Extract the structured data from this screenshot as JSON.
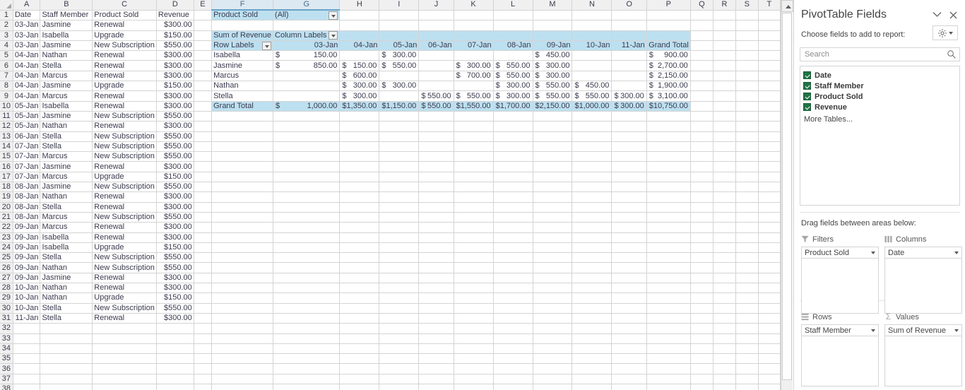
{
  "spreadsheet": {
    "column_letters": [
      "A",
      "B",
      "C",
      "D",
      "E",
      "F",
      "G",
      "H",
      "I",
      "J",
      "K",
      "L",
      "M",
      "N",
      "O",
      "P",
      "Q",
      "R",
      "S",
      "T"
    ],
    "selected_columns": [
      "F",
      "G"
    ],
    "source_table": {
      "headers": [
        "Date",
        "Staff Member",
        "Product Sold",
        "Revenue"
      ],
      "rows": [
        [
          "03-Jan",
          "Jasmine",
          "Renewal",
          "$300.00"
        ],
        [
          "03-Jan",
          "Isabella",
          "Upgrade",
          "$150.00"
        ],
        [
          "03-Jan",
          "Jasmine",
          "New Subscription",
          "$550.00"
        ],
        [
          "04-Jan",
          "Nathan",
          "Renewal",
          "$300.00"
        ],
        [
          "04-Jan",
          "Stella",
          "Renewal",
          "$300.00"
        ],
        [
          "04-Jan",
          "Marcus",
          "Renewal",
          "$300.00"
        ],
        [
          "04-Jan",
          "Jasmine",
          "Upgrade",
          "$150.00"
        ],
        [
          "04-Jan",
          "Marcus",
          "Renewal",
          "$300.00"
        ],
        [
          "05-Jan",
          "Isabella",
          "Renewal",
          "$300.00"
        ],
        [
          "05-Jan",
          "Jasmine",
          "New Subscription",
          "$550.00"
        ],
        [
          "05-Jan",
          "Nathan",
          "Renewal",
          "$300.00"
        ],
        [
          "06-Jan",
          "Stella",
          "New Subscription",
          "$550.00"
        ],
        [
          "07-Jan",
          "Stella",
          "New Subscription",
          "$550.00"
        ],
        [
          "07-Jan",
          "Marcus",
          "New Subscription",
          "$550.00"
        ],
        [
          "07-Jan",
          "Jasmine",
          "Renewal",
          "$300.00"
        ],
        [
          "07-Jan",
          "Marcus",
          "Upgrade",
          "$150.00"
        ],
        [
          "08-Jan",
          "Jasmine",
          "New Subscription",
          "$550.00"
        ],
        [
          "08-Jan",
          "Nathan",
          "Renewal",
          "$300.00"
        ],
        [
          "08-Jan",
          "Stella",
          "Renewal",
          "$300.00"
        ],
        [
          "08-Jan",
          "Marcus",
          "New Subscription",
          "$550.00"
        ],
        [
          "09-Jan",
          "Marcus",
          "Renewal",
          "$300.00"
        ],
        [
          "09-Jan",
          "Isabella",
          "Renewal",
          "$300.00"
        ],
        [
          "09-Jan",
          "Isabella",
          "Upgrade",
          "$150.00"
        ],
        [
          "09-Jan",
          "Stella",
          "New Subscription",
          "$550.00"
        ],
        [
          "09-Jan",
          "Nathan",
          "New Subscription",
          "$550.00"
        ],
        [
          "09-Jan",
          "Jasmine",
          "Renewal",
          "$300.00"
        ],
        [
          "10-Jan",
          "Nathan",
          "Renewal",
          "$300.00"
        ],
        [
          "10-Jan",
          "Nathan",
          "Upgrade",
          "$150.00"
        ],
        [
          "10-Jan",
          "Stella",
          "New Subscription",
          "$550.00"
        ],
        [
          "11-Jan",
          "Stella",
          "Renewal",
          "$300.00"
        ]
      ]
    },
    "pivot": {
      "filter_field_label": "Product Sold",
      "filter_value": "(All)",
      "value_header": "Sum of Revenue",
      "column_labels_header": "Column Labels",
      "row_labels_header": "Row Labels",
      "date_columns": [
        "03-Jan",
        "04-Jan",
        "05-Jan",
        "06-Jan",
        "07-Jan",
        "08-Jan",
        "09-Jan",
        "10-Jan",
        "11-Jan"
      ],
      "grand_total_header": "Grand Total",
      "rows": [
        {
          "name": "Isabella",
          "values": [
            "150.00",
            "",
            "300.00",
            "",
            "",
            "",
            "450.00",
            "",
            ""
          ],
          "total": "900.00"
        },
        {
          "name": "Jasmine",
          "values": [
            "850.00",
            "150.00",
            "550.00",
            "",
            "300.00",
            "550.00",
            "300.00",
            "",
            ""
          ],
          "total": "2,700.00"
        },
        {
          "name": "Marcus",
          "values": [
            "",
            "600.00",
            "",
            "",
            "700.00",
            "550.00",
            "300.00",
            "",
            ""
          ],
          "total": "2,150.00"
        },
        {
          "name": "Nathan",
          "values": [
            "",
            "300.00",
            "300.00",
            "",
            "",
            "300.00",
            "550.00",
            "450.00",
            ""
          ],
          "total": "1,900.00"
        },
        {
          "name": "Stella",
          "values": [
            "",
            "300.00",
            "",
            "550.00",
            "550.00",
            "300.00",
            "550.00",
            "550.00",
            "300.00"
          ],
          "total": "3,100.00"
        }
      ],
      "grand_total_row": {
        "label": "Grand Total",
        "values": [
          "1,000.00",
          "1,350.00",
          "1,150.00",
          "550.00",
          "1,550.00",
          "1,700.00",
          "2,150.00",
          "1,000.00",
          "300.00"
        ],
        "total": "10,750.00"
      },
      "currency_symbol": "$"
    }
  },
  "fields_panel": {
    "title": "PivotTable Fields",
    "choose_label": "Choose fields to add to report:",
    "search_placeholder": "Search",
    "search_value": "",
    "fields": [
      {
        "label": "Date",
        "checked": true
      },
      {
        "label": "Staff Member",
        "checked": true
      },
      {
        "label": "Product Sold",
        "checked": true
      },
      {
        "label": "Revenue",
        "checked": true
      }
    ],
    "more_tables": "More Tables...",
    "drag_label": "Drag fields between areas below:",
    "areas": [
      {
        "name": "Filters",
        "icon": "filter-icon",
        "field": "Product Sold"
      },
      {
        "name": "Columns",
        "icon": "columns-icon",
        "field": "Date"
      },
      {
        "name": "Rows",
        "icon": "rows-icon",
        "field": "Staff Member"
      },
      {
        "name": "Values",
        "icon": "sigma-icon",
        "field": "Sum of Revenue"
      }
    ],
    "accent_color": "#217346",
    "pivot_fill": "#bde0f0"
  }
}
